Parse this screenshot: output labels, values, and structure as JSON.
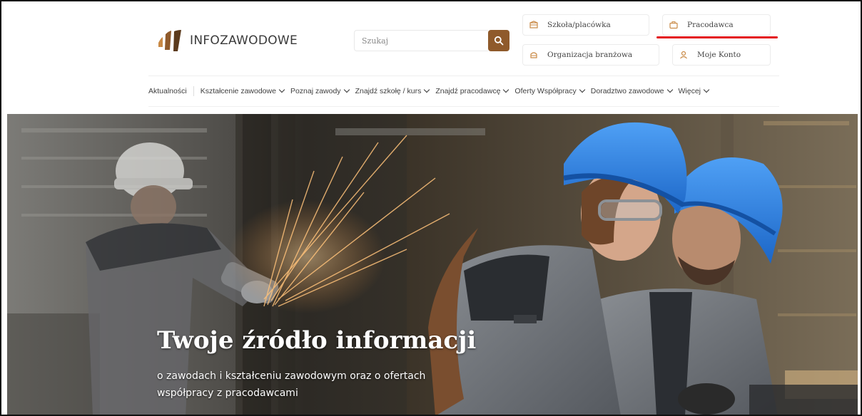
{
  "brand": {
    "name": "INFOZAWODOWE",
    "accent": "#8f5a2b",
    "logo_colors": [
      "#c98a46",
      "#8f5a2b",
      "#5b3a1c"
    ]
  },
  "search": {
    "placeholder": "Szukaj",
    "button_icon": "search-icon"
  },
  "quick_links": {
    "school": {
      "label": "Szkoła/placówka",
      "icon": "school-icon"
    },
    "employer": {
      "label": "Pracodawca",
      "icon": "briefcase-icon",
      "underline_color": "#e4131a"
    },
    "industry": {
      "label": "Organizacja branżowa",
      "icon": "organization-icon"
    },
    "account": {
      "label": "Moje Konto",
      "icon": "user-icon"
    }
  },
  "nav": {
    "items": [
      {
        "label": "Aktualności",
        "has_dropdown": false
      },
      {
        "label": "Kształcenie zawodowe",
        "has_dropdown": true
      },
      {
        "label": "Poznaj zawody",
        "has_dropdown": true
      },
      {
        "label": "Znajdź szkołę / kurs",
        "has_dropdown": true
      },
      {
        "label": "Znajdź pracodawcę",
        "has_dropdown": true
      },
      {
        "label": "Oferty Współpracy",
        "has_dropdown": true
      },
      {
        "label": "Doradztwo zawodowe",
        "has_dropdown": true
      },
      {
        "label": "Więcej",
        "has_dropdown": true
      }
    ]
  },
  "hero": {
    "title": "Twoje źródło informacji",
    "subtitle": "o zawodach i kształceniu zawodowym oraz o ofertach współpracy z pracodawcami",
    "helmet_color": "#2a7fe0"
  }
}
